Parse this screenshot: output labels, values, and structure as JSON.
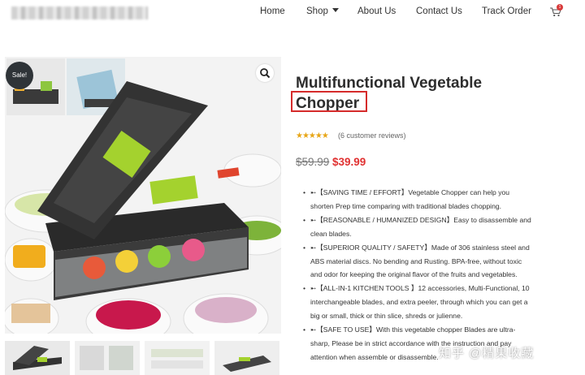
{
  "header": {
    "nav": [
      "Home",
      "Shop",
      "About Us",
      "Contact Us",
      "Track Order"
    ],
    "cart_count": "1"
  },
  "gallery": {
    "badge": "Sale!"
  },
  "product": {
    "title_line1": "Multifunctional Vegetable",
    "title_line2": "Chopper",
    "rating": "★★★★★",
    "rating_value": 5,
    "reviews": "(6 customer reviews)",
    "price_old": "$59.99",
    "price_new": "$39.99",
    "bullets": [
      "➸【SAVING TIME / EFFORT】Vegetable Chopper can help you",
      "shorten Prep time comparing with traditional blades chopping.",
      "➸【REASONABLE / HUMANIZED DESIGN】Easy to disassemble and",
      "clean blades.",
      "➸【SUPERIOR QUALITY / SAFETY】Made of 306 stainless steel and",
      "ABS material discs. No bending and Rusting. BPA-free, without toxic",
      "and odor for keeping the original flavor of the fruits and vegetables.",
      "➸【ALL-IN-1 KITCHEN TOOLS 】12 accessories, Multi-Functional, 10",
      "interchangeable blades, and extra peeler, through which you can get a",
      "big or small, thick or thin slice, shreds or julienne.",
      "➸【SAFE TO USE】With this vegetable chopper Blades are ultra-",
      "sharp, Please be in strict accordance with the instruction and pay",
      "attention when assemble or disassemble."
    ]
  },
  "watermark": "知乎 @精果收藏",
  "colors": {
    "accent": "#e03131",
    "highlight_box": "#d52b2b",
    "stars": "#e7a618"
  }
}
